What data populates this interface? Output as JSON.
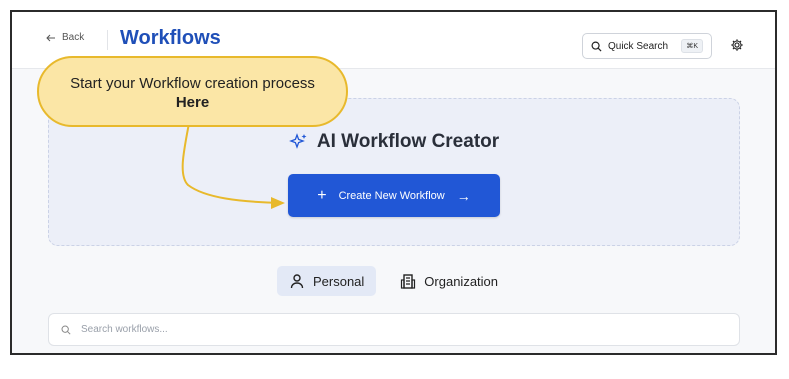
{
  "header": {
    "back_label": "Back",
    "title": "Workflows",
    "quick_search_label": "Quick Search",
    "quick_search_shortcut": "⌘K"
  },
  "creator": {
    "title": "AI Workflow Creator",
    "create_button_label": "Create New Workflow"
  },
  "tabs": [
    {
      "label": "Personal",
      "icon": "person-icon",
      "active": true
    },
    {
      "label": "Organization",
      "icon": "building-icon",
      "active": false
    }
  ],
  "search": {
    "placeholder": "Search workflows..."
  },
  "callout": {
    "line1": "Start your Workflow creation process",
    "line2": "Here"
  },
  "colors": {
    "brand": "#1f4fb8",
    "button": "#2157d6",
    "callout_fill": "#fbe6a6",
    "callout_border": "#e8b92c"
  }
}
